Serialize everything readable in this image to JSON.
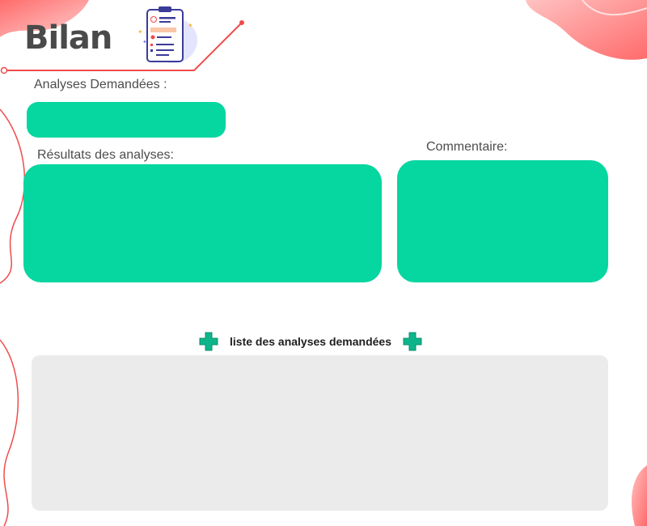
{
  "header": {
    "title": "Bilan",
    "icon": "medical-clipboard-icon"
  },
  "form": {
    "analyses_label": "Analyses Demandées :",
    "analyses_value": "",
    "results_label": "Résultats des analyses:",
    "results_value": "",
    "comment_label": "Commentaire:",
    "comment_value": ""
  },
  "list": {
    "title": "liste des analyses demandées",
    "icon": "plus-icon",
    "items": []
  },
  "colors": {
    "accent_green": "#06d6a0",
    "accent_red": "#ef4b4b",
    "blob_pink": "#ff8a8a",
    "list_background": "#ebebeb",
    "title_text": "#4a4a4a"
  }
}
